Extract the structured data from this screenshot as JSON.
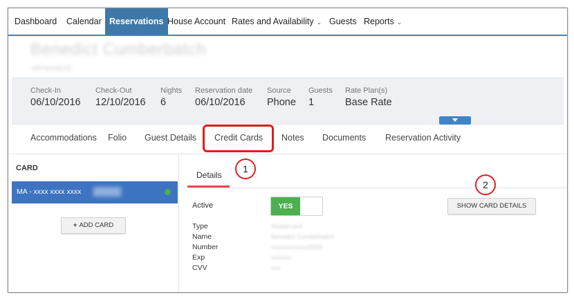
{
  "nav": {
    "items": [
      {
        "label": "Dashboard"
      },
      {
        "label": "Calendar"
      },
      {
        "label": "Reservations"
      },
      {
        "label": "House Account"
      },
      {
        "label": "Rates and Availability"
      },
      {
        "label": "Guests"
      },
      {
        "label": "Reports"
      }
    ],
    "active": "Reservations"
  },
  "guest": {
    "name": "Benedict Cumberbatch",
    "id": "4RFMX9E0S"
  },
  "summary": {
    "checkin": {
      "label": "Check-In",
      "value": "06/10/2016"
    },
    "checkout": {
      "label": "Check-Out",
      "value": "12/10/2016"
    },
    "nights": {
      "label": "Nights",
      "value": "6"
    },
    "resdate": {
      "label": "Reservation date",
      "value": "06/10/2016"
    },
    "source": {
      "label": "Source",
      "value": "Phone"
    },
    "guests": {
      "label": "Guests",
      "value": "1"
    },
    "rateplan": {
      "label": "Rate Plan(s)",
      "value": "Base Rate"
    }
  },
  "tabs": [
    {
      "label": "Accommodations"
    },
    {
      "label": "Folio"
    },
    {
      "label": "Guest Details"
    },
    {
      "label": "Credit Cards"
    },
    {
      "label": "Notes"
    },
    {
      "label": "Documents"
    },
    {
      "label": "Reservation Activity"
    }
  ],
  "cards_panel": {
    "header": "CARD",
    "card_label": "MA - xxxx xxxx xxxx",
    "add_button": "ADD CARD"
  },
  "details": {
    "tab_label": "Details",
    "active_label": "Active",
    "toggle_label": "YES",
    "show_button": "SHOW CARD DETAILS",
    "fields": [
      {
        "label": "Type",
        "value": "Mastercard"
      },
      {
        "label": "Name",
        "value": "Benedict Cumberbatch"
      },
      {
        "label": "Number",
        "value": "xxxxxxxxxxxx0055"
      },
      {
        "label": "Exp",
        "value": "xx/xxxx"
      },
      {
        "label": "CVV",
        "value": "xxx"
      }
    ]
  },
  "callouts": {
    "one": "1",
    "two": "2"
  },
  "colors": {
    "nav_active": "#3e78a8",
    "card_selected": "#3d74c1",
    "toggle_on": "#4caf50",
    "callout": "#e01e1e"
  }
}
